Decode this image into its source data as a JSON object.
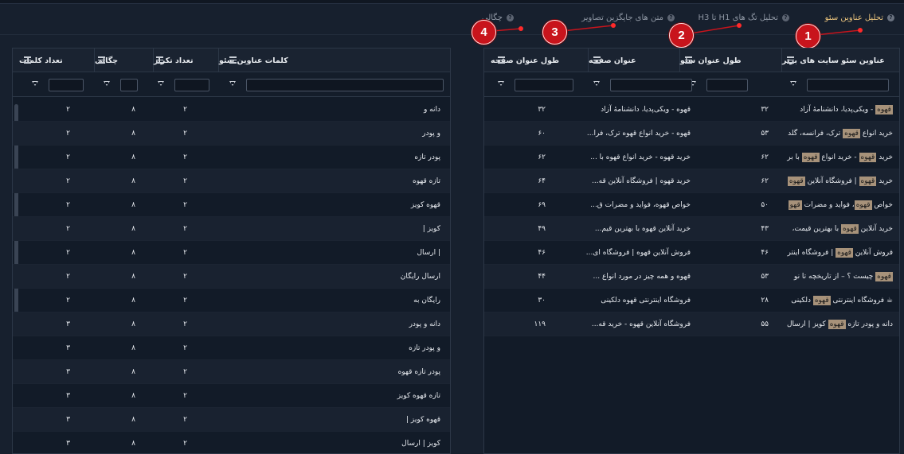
{
  "tabs": [
    {
      "label": "تحلیل عناوین سئو",
      "active": true
    },
    {
      "label": "تحلیل تگ های H1 تا H3",
      "active": false
    },
    {
      "label": "متن های جایگزین تصاویر",
      "active": false
    },
    {
      "label": "چگالی",
      "active": false
    }
  ],
  "tab_help": "?",
  "markers": [
    "1",
    "2",
    "3",
    "4"
  ],
  "right_table": {
    "headers": [
      "عناوین سئو سایت های برتر",
      "طول عنوان سئو",
      "عنوان صفحه",
      "طول عنوان صفحه"
    ],
    "rows": [
      {
        "pre": "",
        "hl": "قهوه",
        "post": " - ویکی‌پدیا، دانشنامهٔ آزاد",
        "seo_len": "۳۲",
        "page_title": "قهوه - ویکی‌پدیا، دانشنامهٔ آزاد",
        "page_len": "۳۲"
      },
      {
        "pre": "خرید انواع ",
        "hl": "قهوه",
        "post": " ترک، فرانسه، گلد",
        "seo_len": "۵۳",
        "page_title": "قهوه - خرید انواع قهوه ترک، فرا...",
        "page_len": "۶۰"
      },
      {
        "pre": "خرید ",
        "hl": "قهوه",
        "post": " - خرید انواع ",
        "hl2": "قهوه",
        "post2": " با بر",
        "seo_len": "۶۲",
        "page_title": "خرید قهوه - خرید انواع قهوه با ...",
        "page_len": "۶۲"
      },
      {
        "pre": "خرید ",
        "hl": "قهوه",
        "post": " | فروشگاه آنلاین ",
        "hl2": "قهوه",
        "post2": "",
        "seo_len": "۶۲",
        "page_title": "خرید قهوه | فروشگاه آنلاین قه...",
        "page_len": "۶۴"
      },
      {
        "pre": "خواص ",
        "hl": "قهوه",
        "post": "، فواید و مضرات ",
        "hl2": "قهو",
        "post2": "",
        "seo_len": "۵۰",
        "page_title": "خواص قهوه، فواید و مضرات ق...",
        "page_len": "۶۹"
      },
      {
        "pre": "خرید آنلاین ",
        "hl": "قهوه",
        "post": " با بهترین قیمت،",
        "seo_len": "۴۳",
        "page_title": "خرید آنلاین قهوه با بهترین قیم...",
        "page_len": "۴۹"
      },
      {
        "pre": "فروش آنلاین ",
        "hl": "قهوه",
        "post": " | فروشگاه اینتر",
        "seo_len": "۴۶",
        "page_title": "فروش آنلاین قهوه | فروشگاه ای...",
        "page_len": "۴۶"
      },
      {
        "pre": "",
        "hl": "قهوه",
        "post": " چیست ؟ – از تاریخچه تا نو",
        "seo_len": "۵۳",
        "page_title": "قهوه و همه چیز در مورد انواع ...",
        "page_len": "۴۴"
      },
      {
        "pre": "☕ فروشگاه اینترنتی ",
        "hl": "قهوه",
        "post": " دلکینی",
        "seo_len": "۲۸",
        "page_title": "فروشگاه اینترنتی قهوه دلکینی",
        "page_len": "۳۰"
      },
      {
        "pre": "دانه و پودر تازه ",
        "hl": "قهوه",
        "post": " کویز | ارسال",
        "seo_len": "۵۵",
        "page_title": "فروشگاه آنلاین قهوه - خرید قه...",
        "page_len": "۱۱۹"
      }
    ]
  },
  "left_table": {
    "headers": [
      "کلمات عناوین سئو",
      "تعداد تکرار",
      "چگالی",
      "تعداد کلمات"
    ],
    "rows": [
      {
        "word": "دانه و",
        "repeat": "۲",
        "density": "۸",
        "count": "۲"
      },
      {
        "word": "و پودر",
        "repeat": "۲",
        "density": "۸",
        "count": "۲"
      },
      {
        "word": "پودر تازه",
        "repeat": "۲",
        "density": "۸",
        "count": "۲"
      },
      {
        "word": "تازه قهوه",
        "repeat": "۲",
        "density": "۸",
        "count": "۲"
      },
      {
        "word": "قهوه کویز",
        "repeat": "۲",
        "density": "۸",
        "count": "۲"
      },
      {
        "word": "کویز |",
        "repeat": "۲",
        "density": "۸",
        "count": "۲"
      },
      {
        "word": "| ارسال",
        "repeat": "۲",
        "density": "۸",
        "count": "۲"
      },
      {
        "word": "ارسال رایگان",
        "repeat": "۲",
        "density": "۸",
        "count": "۲"
      },
      {
        "word": "رایگان به",
        "repeat": "۲",
        "density": "۸",
        "count": "۲"
      },
      {
        "word": "دانه و پودر",
        "repeat": "۲",
        "density": "۸",
        "count": "۳"
      },
      {
        "word": "و پودر تازه",
        "repeat": "۲",
        "density": "۸",
        "count": "۳"
      },
      {
        "word": "پودر تازه قهوه",
        "repeat": "۲",
        "density": "۸",
        "count": "۳"
      },
      {
        "word": "تازه قهوه کویز",
        "repeat": "۲",
        "density": "۸",
        "count": "۳"
      },
      {
        "word": "قهوه کویز |",
        "repeat": "۲",
        "density": "۸",
        "count": "۳"
      },
      {
        "word": "کویز | ارسال",
        "repeat": "۲",
        "density": "۸",
        "count": "۳"
      }
    ]
  },
  "colors": {
    "accent": "#e8c27c",
    "highlight": "#a7927a",
    "marker": "#c8141c"
  }
}
